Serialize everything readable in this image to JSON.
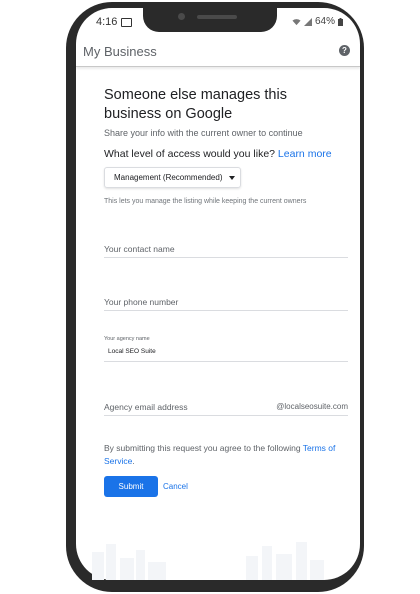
{
  "status_bar": {
    "time": "4:16",
    "battery": "64%"
  },
  "app_bar": {
    "title": "My Business",
    "help_icon": "help-circle-icon"
  },
  "form": {
    "heading": "Someone else manages this business on Google",
    "subtitle": "Share your info with the current owner to continue",
    "question": "What level of access would you like?",
    "learn_more": "Learn more",
    "access_selected": "Management (Recommended)",
    "access_hint": "This lets you manage the listing while keeping the current owners",
    "contact_name_placeholder": "Your contact name",
    "phone_placeholder": "Your phone number",
    "agency_name_label": "Your agency name",
    "agency_name_value": "Local SEO Suite",
    "agency_email_placeholder": "Agency email address",
    "email_domain_suffix": "@localseosuite.com",
    "terms_text": "By submitting this request you agree to the following ",
    "terms_link": "Terms of Service",
    "terms_end": ".",
    "submit_label": "Submit",
    "cancel_label": "Cancel"
  },
  "colors": {
    "accent": "#1a73e8",
    "frame": "#2a2a2a"
  }
}
